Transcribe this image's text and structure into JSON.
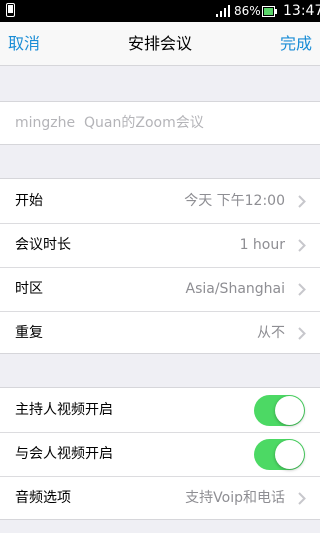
{
  "status_bar": {
    "battery_percent": "86%",
    "time": "13:47",
    "icons": [
      "phone-icon",
      "signal-icon",
      "battery-icon"
    ]
  },
  "nav": {
    "cancel_label": "取消",
    "title": "安排会议",
    "done_label": "完成"
  },
  "topic": {
    "placeholder": "mingzhe  Quan的Zoom会议"
  },
  "schedule": {
    "start": {
      "label": "开始",
      "value": "今天 下午12:00"
    },
    "duration": {
      "label": "会议时长",
      "value": "1 hour"
    },
    "timezone": {
      "label": "时区",
      "value": "Asia/Shanghai"
    },
    "repeat": {
      "label": "重复",
      "value": "从不"
    }
  },
  "options": {
    "host_video": {
      "label": "主持人视频开启",
      "on": true
    },
    "participant_video": {
      "label": "与会人视频开启",
      "on": true
    },
    "audio": {
      "label": "音频选项",
      "value": "支持Voip和电话"
    }
  },
  "colors": {
    "accent": "#1a8dd6",
    "toggle_on": "#4cd964",
    "background": "#efeff4",
    "secondary_text": "#8e8e93"
  }
}
